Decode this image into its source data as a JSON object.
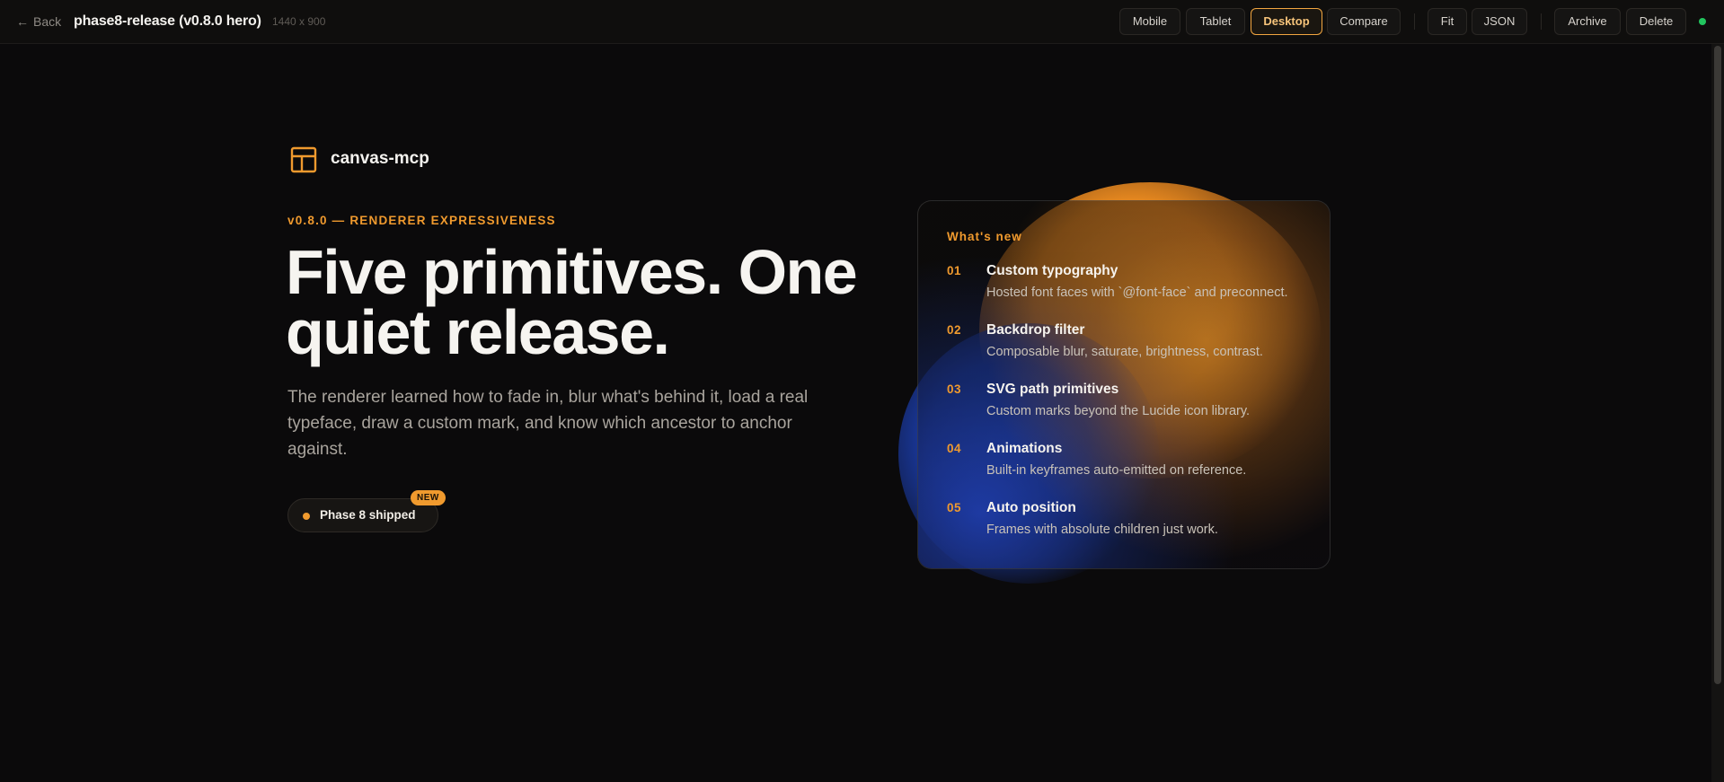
{
  "toolbar": {
    "back_label": "Back",
    "title": "phase8-release (v0.8.0 hero)",
    "size_label": "1440 x 900",
    "view_buttons": [
      "Mobile",
      "Tablet",
      "Desktop",
      "Compare"
    ],
    "active_view": "Desktop",
    "tools": [
      "Fit",
      "JSON"
    ],
    "actions": [
      "Archive",
      "Delete"
    ],
    "status_color": "#22c55e"
  },
  "hero": {
    "brand_name": "canvas-mcp",
    "eyebrow": "v0.8.0 — RENDERER EXPRESSIVENESS",
    "headline_line1": "Five primitives. One",
    "headline_line2": "quiet release.",
    "subtext": "The renderer learned how to fade in, blur what's behind it, load a real typeface, draw a custom mark, and know which ancestor to anchor against.",
    "pill_label": "Phase 8 shipped",
    "pill_badge": "NEW"
  },
  "whats_new": {
    "title": "What's new",
    "items": [
      {
        "num": "01",
        "title": "Custom typography",
        "desc": "Hosted font faces with `@font-face` and preconnect."
      },
      {
        "num": "02",
        "title": "Backdrop filter",
        "desc": "Composable blur, saturate, brightness, contrast."
      },
      {
        "num": "03",
        "title": "SVG path primitives",
        "desc": "Custom marks beyond the Lucide icon library."
      },
      {
        "num": "04",
        "title": "Animations",
        "desc": "Built-in keyframes auto-emitted on reference."
      },
      {
        "num": "05",
        "title": "Auto position",
        "desc": "Frames with absolute children just work."
      }
    ]
  },
  "colors": {
    "accent": "#f09a2e",
    "background": "#0b0a0b",
    "blue_glow": "#1f49c9"
  }
}
